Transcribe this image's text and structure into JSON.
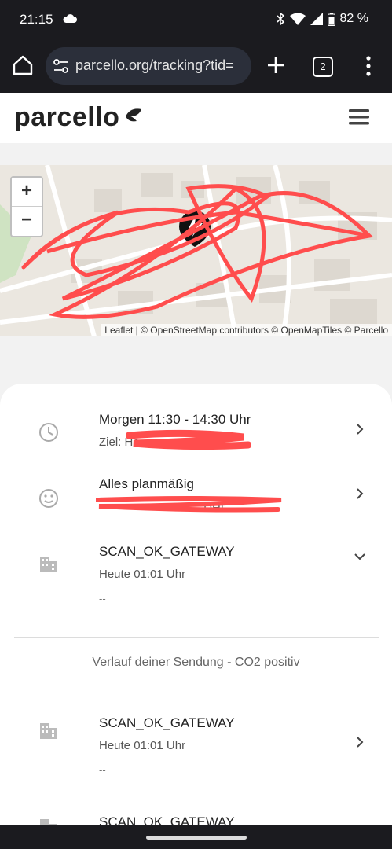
{
  "status_bar": {
    "time": "21:15",
    "battery": "82 %"
  },
  "browser": {
    "url": "parcello.org/tracking?tid=",
    "tab_count": "2"
  },
  "site": {
    "logo": "parcello"
  },
  "map": {
    "zoom_in": "+",
    "zoom_out": "−",
    "attribution": "Leaflet | © OpenStreetMap contributors © OpenMapTiles © Parcello"
  },
  "tracking": {
    "delivery": {
      "title": "Morgen 11:30 - 14:30 Uhr",
      "subtitle": "Ziel: He"
    },
    "status": {
      "title": "Alles planmäßig",
      "subtitle": "- DHL"
    },
    "latest_event": {
      "title": "SCAN_OK_GATEWAY",
      "time": "Heute 01:01 Uhr",
      "note": "--"
    },
    "history_heading": "Verlauf deiner Sendung - CO2 positiv",
    "history": [
      {
        "title": "SCAN_OK_GATEWAY",
        "time": "Heute 01:01 Uhr",
        "note": "--"
      },
      {
        "title": "SCAN_OK_GATEWAY"
      }
    ]
  }
}
